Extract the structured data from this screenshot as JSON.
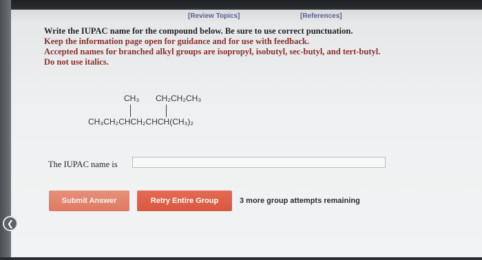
{
  "header": {
    "review_topics": "[Review Topics]",
    "references": "[References]"
  },
  "question": {
    "line1": "Write the IUPAC name for the compound below. Be sure to use correct punctuation.",
    "line2": "Keep the information page open for guidance and for use with feedback.",
    "line3": "Accepted names for branched alkyl groups are isopropyl, isobutyl, sec-butyl, and tert-butyl.",
    "line4": "Do not use italics."
  },
  "structure": {
    "sub1": "CH₃",
    "sub2": "CH₂CH₂CH₃",
    "main": "CH₃CH₂CHCH₂CHCH(CH₃)₂"
  },
  "answer": {
    "label": "The IUPAC name is",
    "value": "",
    "placeholder": ""
  },
  "buttons": {
    "submit": "Submit Answer",
    "retry": "Retry Entire Group"
  },
  "status": {
    "attempts": "3 more group attempts remaining"
  },
  "icons": {
    "back": "back-arrow-icon"
  }
}
